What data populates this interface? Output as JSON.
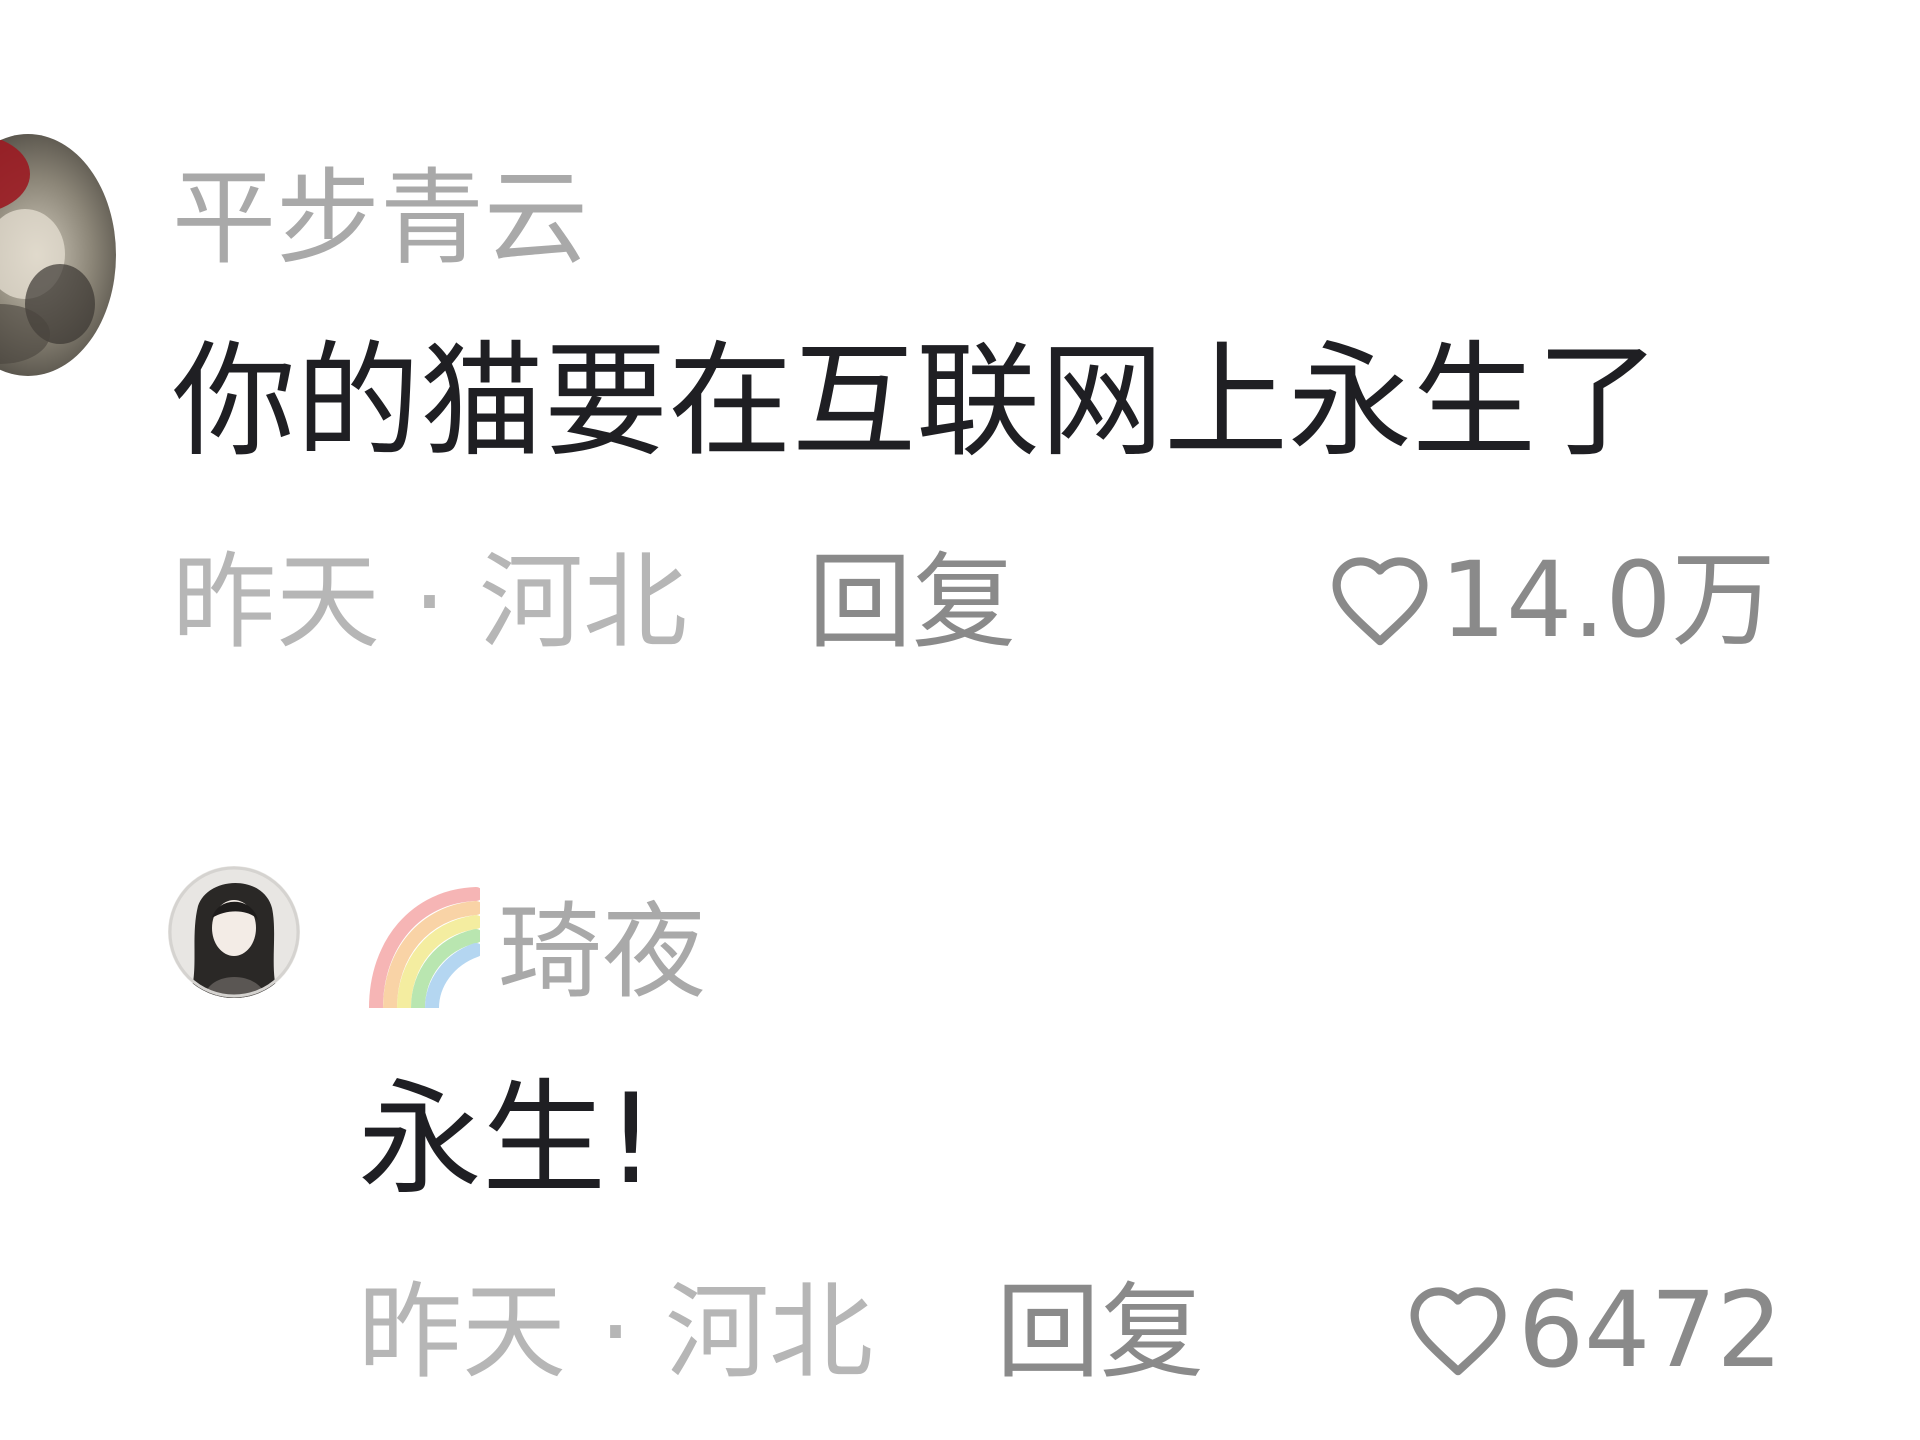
{
  "comments": [
    {
      "username": "平步青云",
      "text": "你的猫要在互联网上永生了",
      "meta": "昨天 · 河北",
      "reply_label": "回复",
      "like_count": "14.0万",
      "avatar_icon": "user-avatar-photo"
    },
    {
      "username": "琦夜",
      "badge_icon": "rainbow-icon",
      "text": "永生!",
      "meta": "昨天 · 河北",
      "reply_label": "回复",
      "like_count": "6472",
      "avatar_icon": "anime-character-avatar"
    }
  ],
  "icons": {
    "like": "heart-outline-icon"
  },
  "colors": {
    "background": "#ffffff",
    "username": "#a9a9a9",
    "content": "#1f1f23",
    "meta": "#b6b6b6",
    "action": "#8a8a8a"
  }
}
